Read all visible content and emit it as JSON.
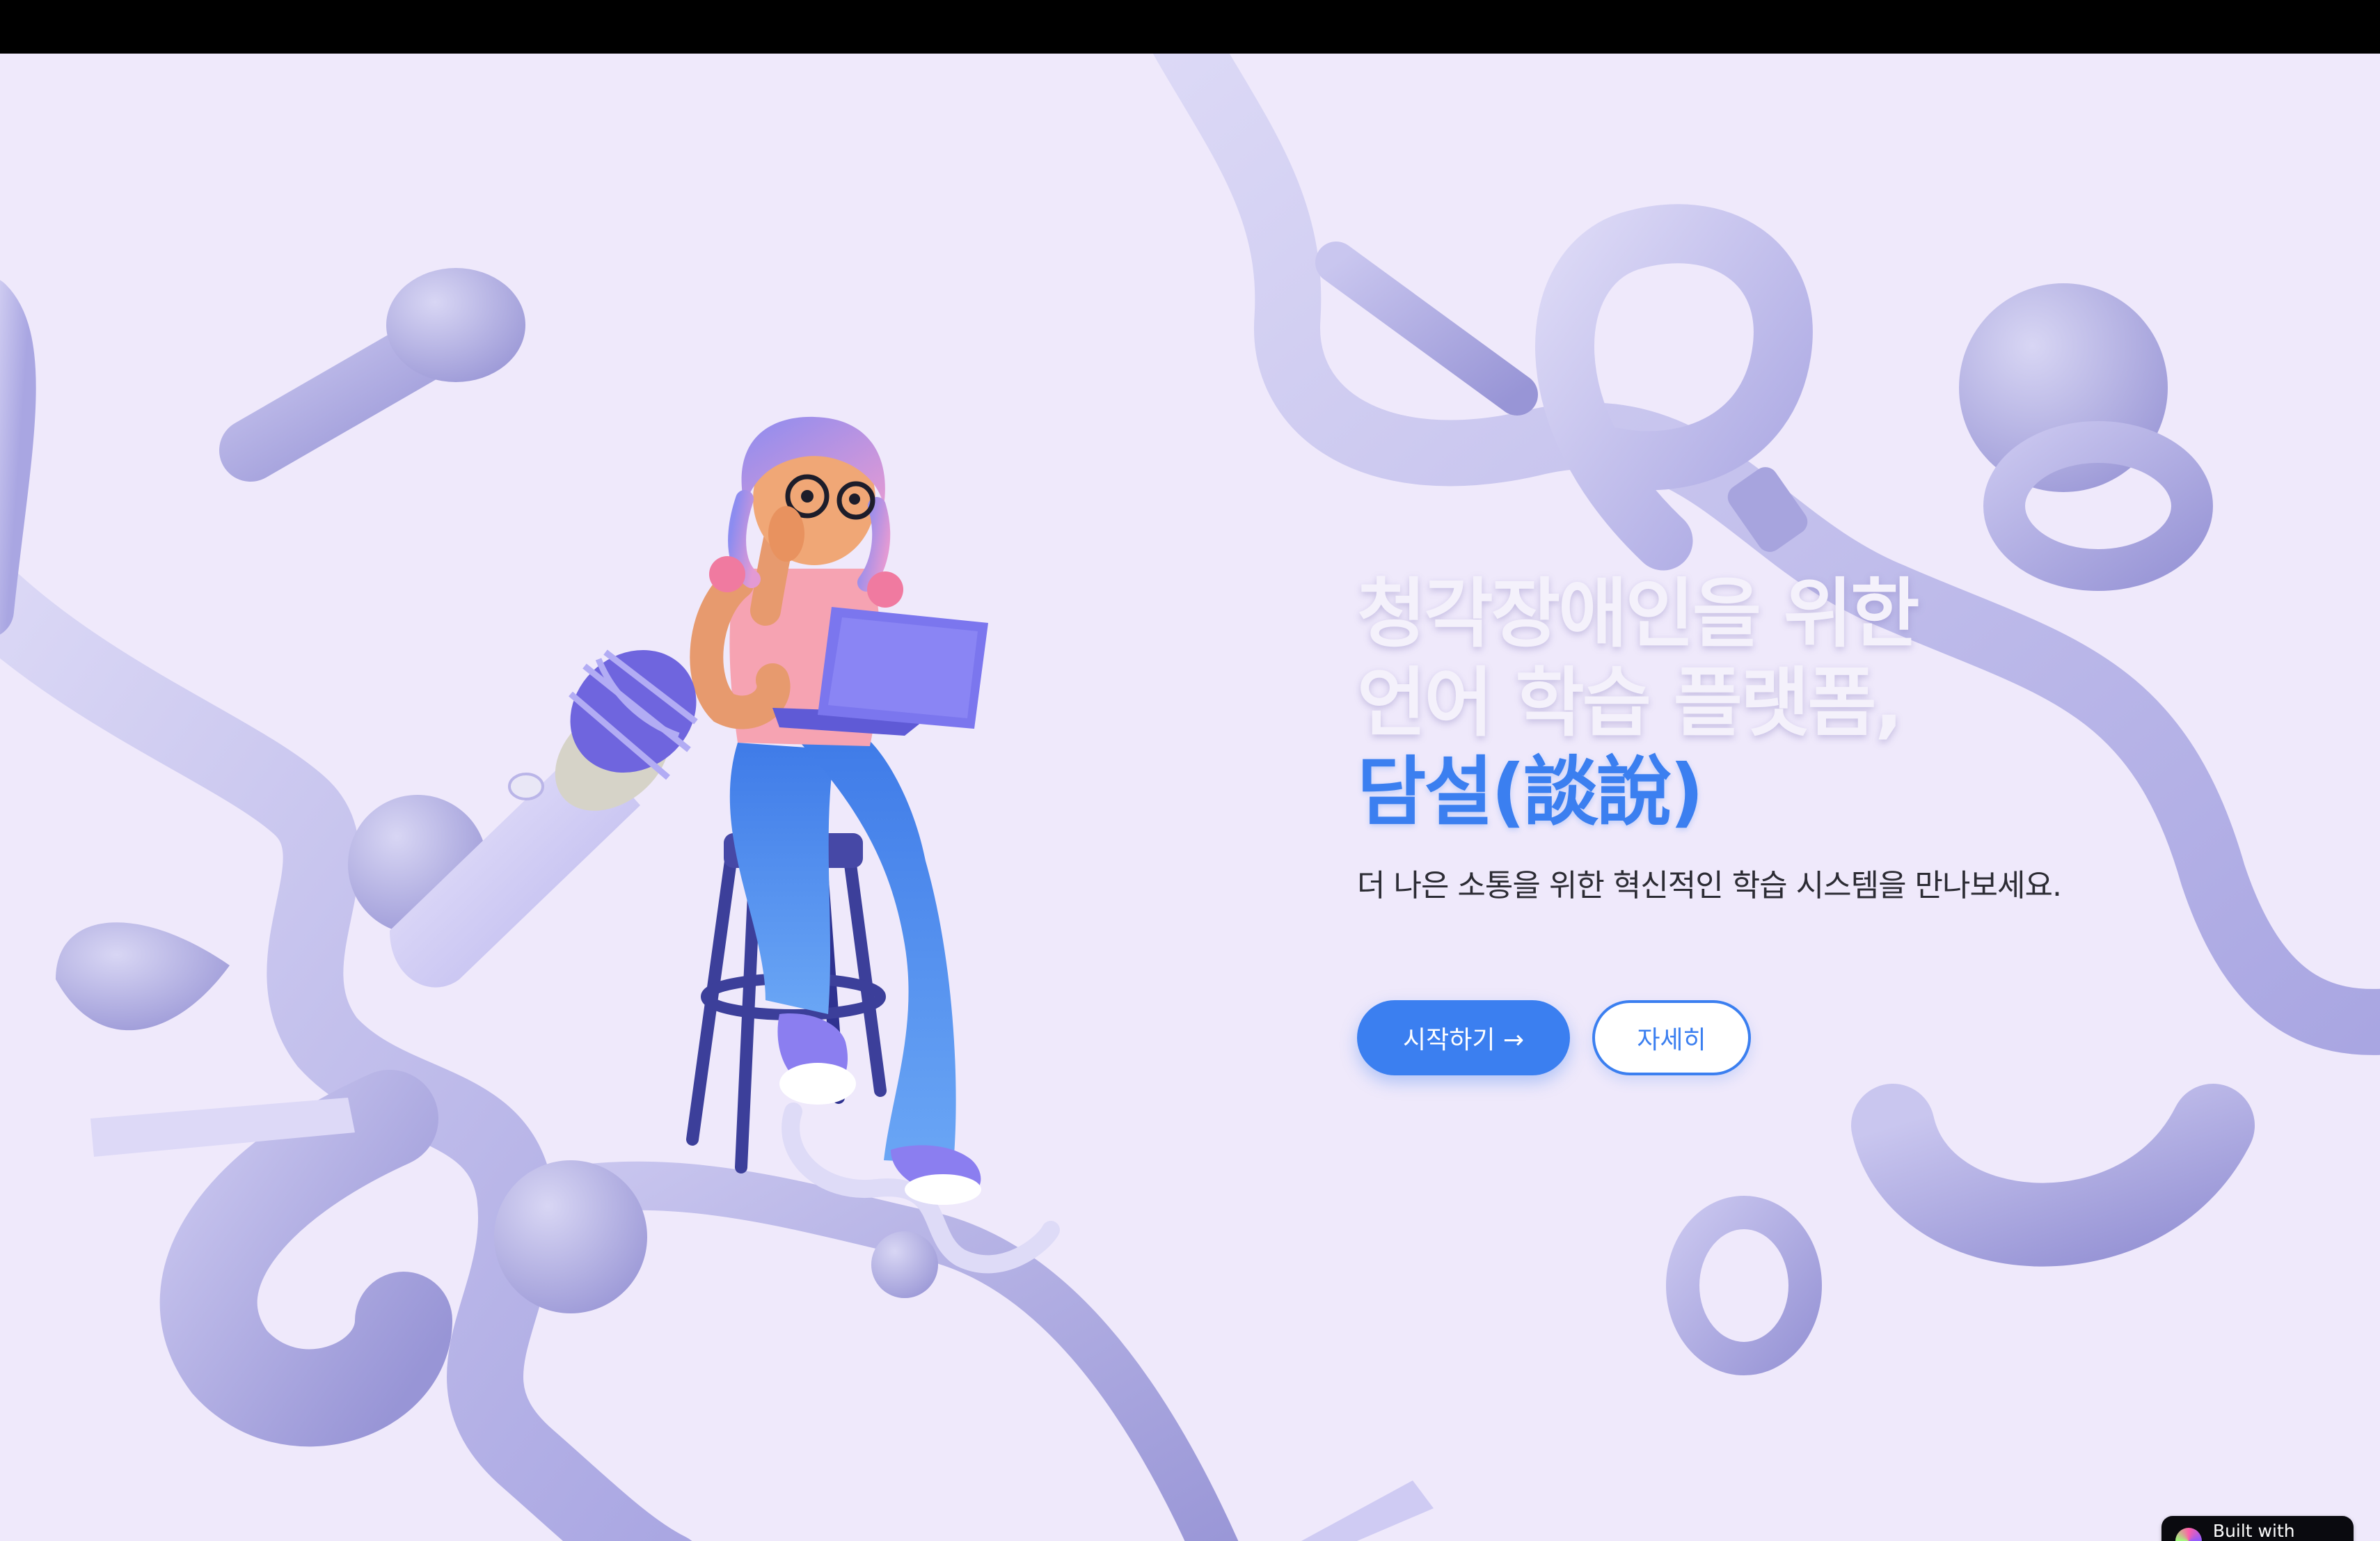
{
  "hero": {
    "headline_line1": "청각장애인을 위한",
    "headline_line2": "언어 학습 플랫폼,",
    "headline_accent": "담설(談說)",
    "subheading": "더 나은 소통을 위한 혁신적인 학습 시스템을 만나보세요."
  },
  "buttons": {
    "start_label": "시작하기 →",
    "details_label": "자세히"
  },
  "badge": {
    "label": "Built with Spline",
    "icon": "spline-logo-icon"
  },
  "colors": {
    "background": "#efe9fb",
    "accent": "#3b7ff0",
    "shape": "#c4c1ee",
    "topbar": "#000000"
  }
}
